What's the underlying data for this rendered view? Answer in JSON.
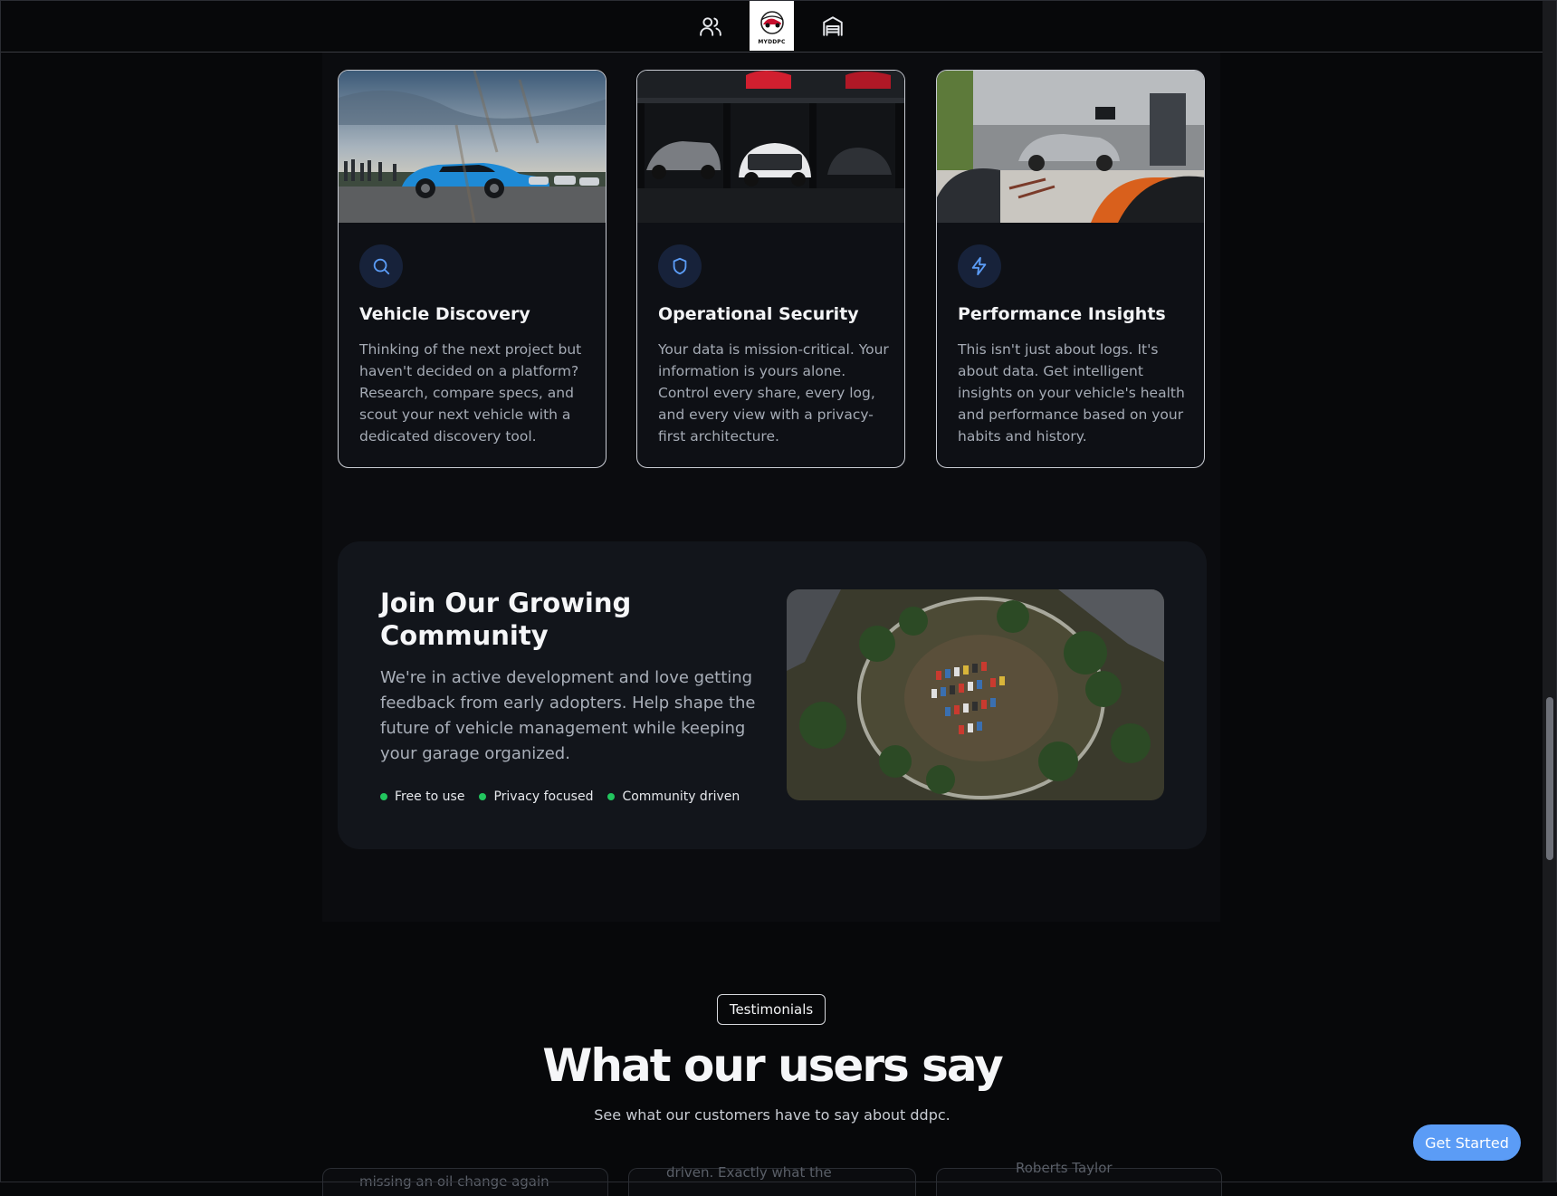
{
  "nav": {
    "items": [
      {
        "name": "community-nav",
        "icon": "users-icon"
      },
      {
        "name": "logo",
        "text": "MYDDPC"
      },
      {
        "name": "garage-nav",
        "icon": "garage-icon"
      }
    ]
  },
  "features": [
    {
      "title": "Vehicle Discovery",
      "icon": "search-icon",
      "description": "Thinking of the next project but haven't decided on a platform? Research, compare specs, and scout your next vehicle with a dedicated discovery tool."
    },
    {
      "title": "Operational Security",
      "icon": "shield-icon",
      "description": "Your data is mission-critical. Your information is yours alone. Control every share, every log, and every view with a privacy-first architecture."
    },
    {
      "title": "Performance Insights",
      "icon": "lightning-icon",
      "description": "This isn't just about logs. It's about data. Get intelligent insights on your vehicle's health and performance based on your habits and history."
    }
  ],
  "community": {
    "title": "Join Our Growing Community",
    "description": "We're in active development and love getting feedback from early adopters. Help shape the future of vehicle management while keeping your garage organized.",
    "tags": [
      "Free to use",
      "Privacy focused",
      "Community driven"
    ],
    "tag_color": "#22c55e"
  },
  "testimonials": {
    "badge": "Testimonials",
    "title": "What our users say",
    "subtitle": "See what our customers have to say about ddpc.",
    "peek": [
      "missing an oil change again",
      "driven. Exactly what the",
      "Roberts Taylor"
    ]
  },
  "cta": {
    "label": "Get Started",
    "color": "#5b9cf6"
  }
}
